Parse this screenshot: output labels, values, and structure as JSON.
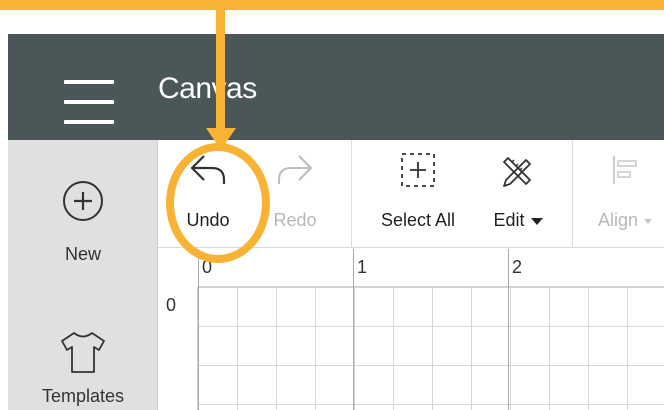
{
  "header": {
    "title": "Canvas",
    "menu_icon": "hamburger-icon"
  },
  "sidebar": {
    "items": [
      {
        "label": "New",
        "icon": "plus-circle-icon"
      },
      {
        "label": "Templates",
        "icon": "tshirt-icon"
      }
    ]
  },
  "toolbar": {
    "undo": {
      "label": "Undo",
      "icon": "undo-arrow-icon"
    },
    "redo": {
      "label": "Redo",
      "icon": "redo-arrow-icon"
    },
    "select_all": {
      "label": "Select All",
      "icon": "select-all-icon"
    },
    "edit": {
      "label": "Edit",
      "icon": "pencil-ruler-icon"
    },
    "align": {
      "label": "Align",
      "icon": "align-icon"
    }
  },
  "ruler": {
    "horizontal": [
      "0",
      "1",
      "2"
    ],
    "vertical": [
      "0"
    ]
  },
  "annotation": {
    "color": "#f8b334"
  },
  "colors": {
    "header_bg": "#4a5657",
    "sidebar_bg": "#e0e0e0",
    "accent": "#f8b334"
  }
}
